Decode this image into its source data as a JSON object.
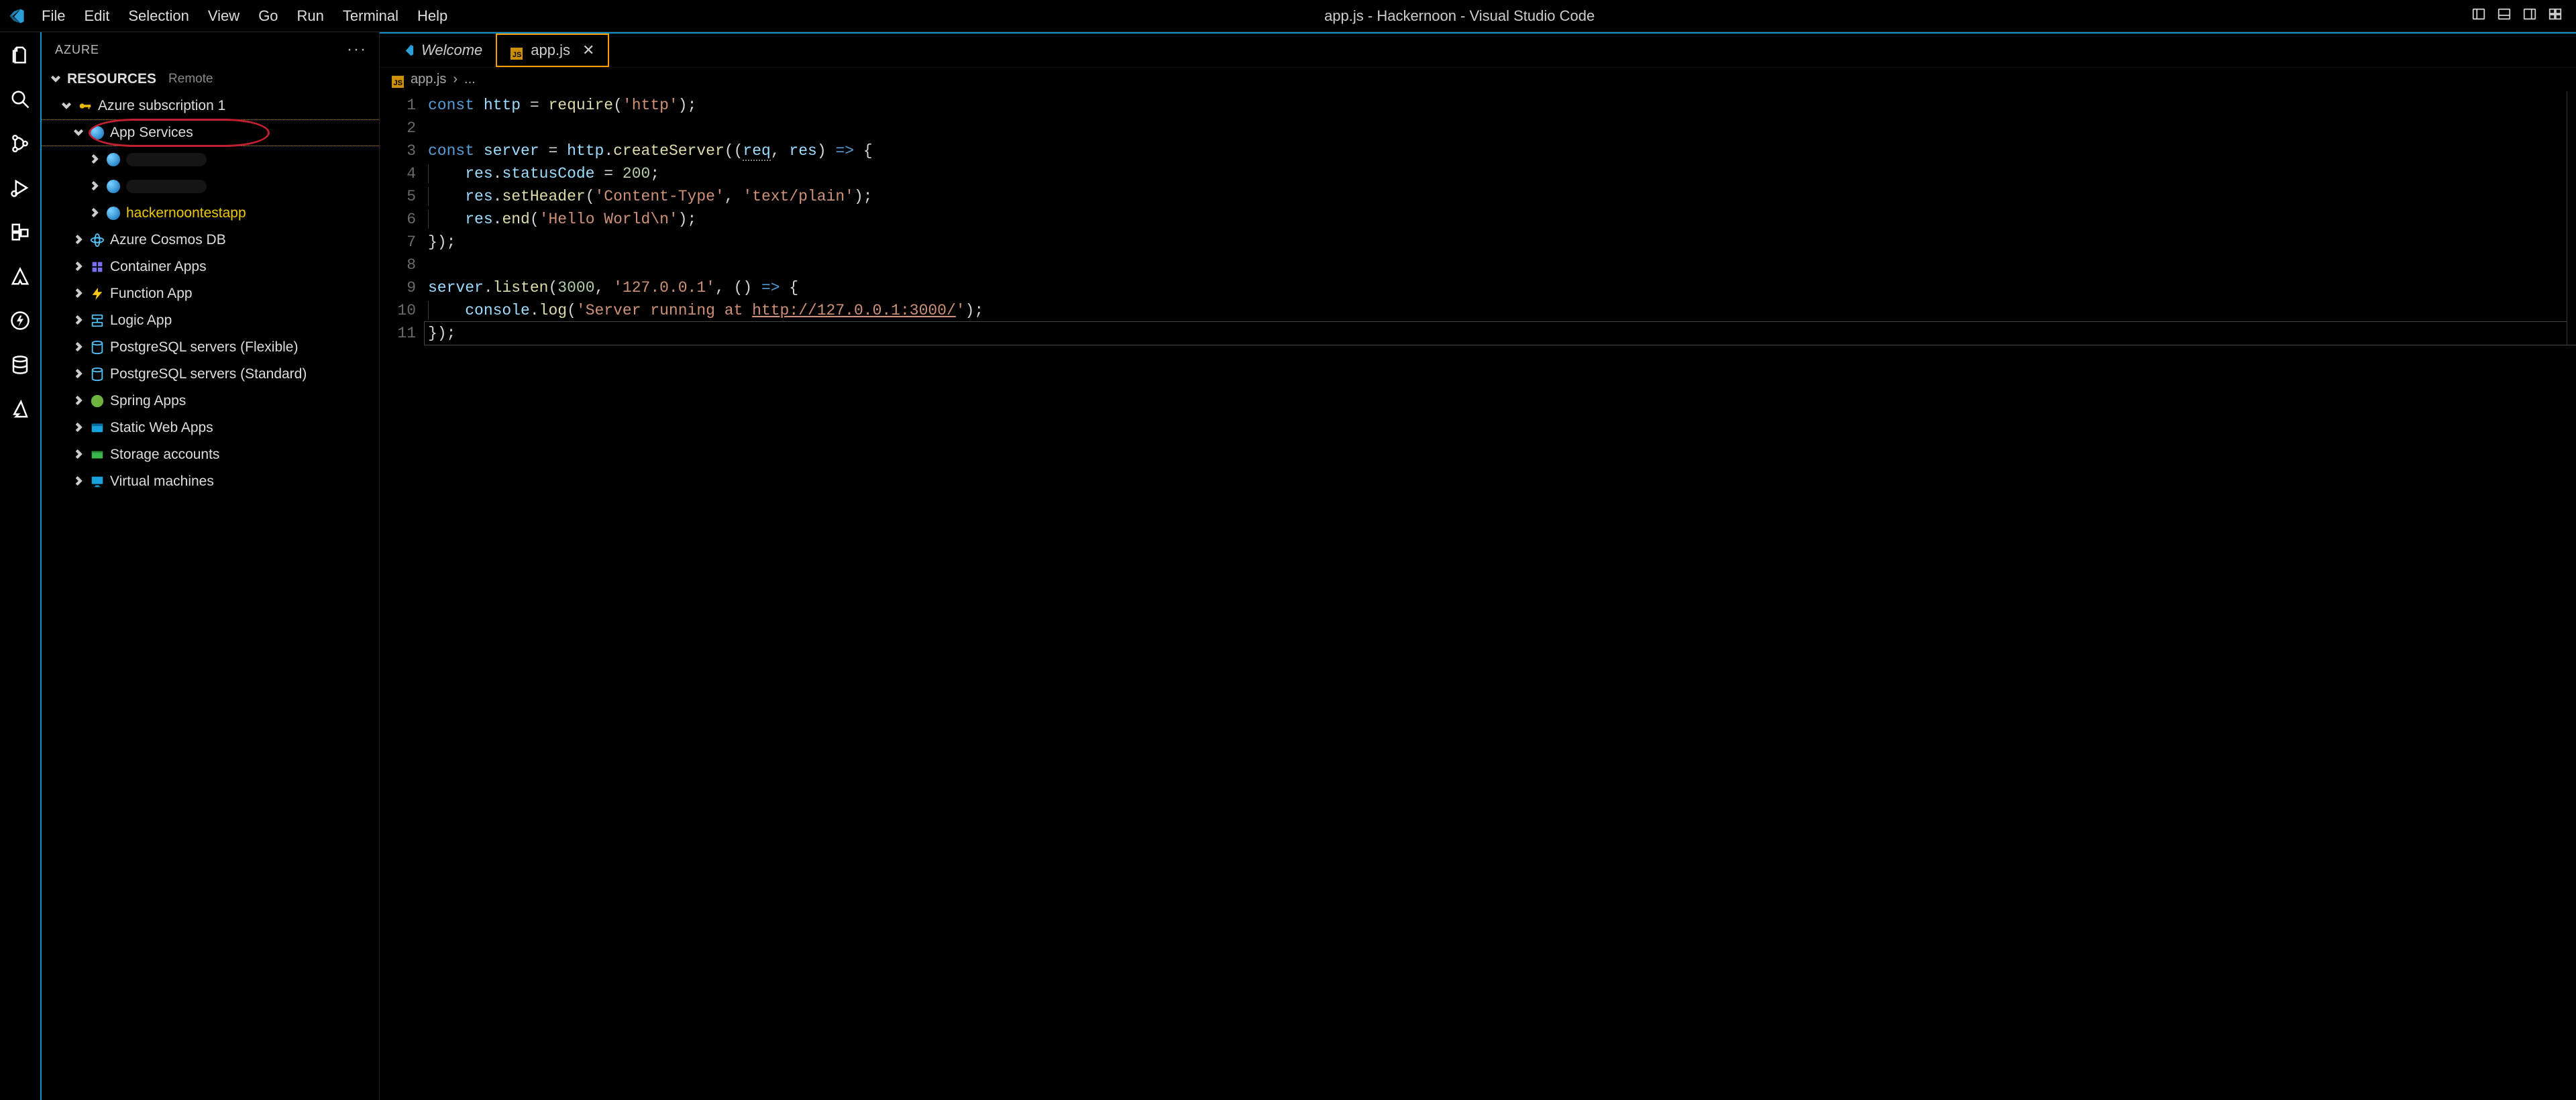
{
  "titlebar": {
    "menus": [
      "File",
      "Edit",
      "Selection",
      "View",
      "Go",
      "Run",
      "Terminal",
      "Help"
    ],
    "title": "app.js - Hackernoon - Visual Studio Code"
  },
  "sidebar": {
    "title": "AZURE",
    "section": {
      "label": "RESOURCES",
      "suffix": "Remote"
    },
    "subscription": "Azure subscription 1",
    "app_services_label": "App Services",
    "app_services_children": [
      {
        "name": "",
        "redacted": true
      },
      {
        "name": "",
        "redacted": true
      },
      {
        "name": "hackernoontestapp",
        "redacted": false,
        "highlight": true
      }
    ],
    "rest": [
      {
        "label": "Azure Cosmos DB",
        "icon": "cosmos"
      },
      {
        "label": "Container Apps",
        "icon": "container"
      },
      {
        "label": "Function App",
        "icon": "function"
      },
      {
        "label": "Logic App",
        "icon": "logic"
      },
      {
        "label": "PostgreSQL servers (Flexible)",
        "icon": "db"
      },
      {
        "label": "PostgreSQL servers (Standard)",
        "icon": "db"
      },
      {
        "label": "Spring Apps",
        "icon": "spring"
      },
      {
        "label": "Static Web Apps",
        "icon": "static"
      },
      {
        "label": "Storage accounts",
        "icon": "storage"
      },
      {
        "label": "Virtual machines",
        "icon": "vm"
      }
    ]
  },
  "tabs": [
    {
      "label": "Welcome",
      "icon": "vscode",
      "active": false
    },
    {
      "label": "app.js",
      "icon": "js",
      "active": true,
      "close": true
    }
  ],
  "breadcrumbs": {
    "file": "app.js",
    "rest": "..."
  },
  "code": {
    "lines": 11,
    "tokens": [
      [
        [
          "kw",
          "const "
        ],
        [
          "var",
          "http"
        ],
        [
          "p",
          " "
        ],
        [
          "p",
          "="
        ],
        [
          "p",
          " "
        ],
        [
          "fn",
          "require"
        ],
        [
          "p",
          "("
        ],
        [
          "str",
          "'http'"
        ],
        [
          "p",
          ")"
        ],
        [
          "p",
          ";"
        ]
      ],
      [],
      [
        [
          "kw",
          "const "
        ],
        [
          "var",
          "server"
        ],
        [
          "p",
          " "
        ],
        [
          "p",
          "="
        ],
        [
          "p",
          " "
        ],
        [
          "var",
          "http"
        ],
        [
          "p",
          "."
        ],
        [
          "fn",
          "createServer"
        ],
        [
          "p",
          "("
        ],
        [
          "p",
          "("
        ],
        [
          "squigvar",
          "req"
        ],
        [
          "p",
          ", "
        ],
        [
          "var",
          "res"
        ],
        [
          "p",
          ")"
        ],
        [
          "p",
          " "
        ],
        [
          "arrow",
          "=>"
        ],
        [
          "p",
          " "
        ],
        [
          "p",
          "{"
        ]
      ],
      [
        [
          "pad",
          "    "
        ],
        [
          "var",
          "res"
        ],
        [
          "p",
          "."
        ],
        [
          "var",
          "statusCode"
        ],
        [
          "p",
          " "
        ],
        [
          "p",
          "="
        ],
        [
          "p",
          " "
        ],
        [
          "num",
          "200"
        ],
        [
          "p",
          ";"
        ]
      ],
      [
        [
          "pad",
          "    "
        ],
        [
          "var",
          "res"
        ],
        [
          "p",
          "."
        ],
        [
          "fn",
          "setHeader"
        ],
        [
          "p",
          "("
        ],
        [
          "str",
          "'Content-Type'"
        ],
        [
          "p",
          ", "
        ],
        [
          "str",
          "'text/plain'"
        ],
        [
          "p",
          ")"
        ],
        [
          "p",
          ";"
        ]
      ],
      [
        [
          "pad",
          "    "
        ],
        [
          "var",
          "res"
        ],
        [
          "p",
          "."
        ],
        [
          "fn",
          "end"
        ],
        [
          "p",
          "("
        ],
        [
          "str",
          "'Hello World\\n'"
        ],
        [
          "p",
          ")"
        ],
        [
          "p",
          ";"
        ]
      ],
      [
        [
          "p",
          "}"
        ],
        [
          "p",
          ")"
        ],
        [
          "p",
          ";"
        ]
      ],
      [],
      [
        [
          "var",
          "server"
        ],
        [
          "p",
          "."
        ],
        [
          "fn",
          "listen"
        ],
        [
          "p",
          "("
        ],
        [
          "num",
          "3000"
        ],
        [
          "p",
          ", "
        ],
        [
          "str",
          "'127.0.0.1'"
        ],
        [
          "p",
          ", "
        ],
        [
          "p",
          "("
        ],
        [
          "p",
          ")"
        ],
        [
          "p",
          " "
        ],
        [
          "arrow",
          "=>"
        ],
        [
          "p",
          " "
        ],
        [
          "p",
          "{"
        ]
      ],
      [
        [
          "pad",
          "    "
        ],
        [
          "var",
          "console"
        ],
        [
          "p",
          "."
        ],
        [
          "fn",
          "log"
        ],
        [
          "p",
          "("
        ],
        [
          "str",
          "'Server running at "
        ],
        [
          "link",
          "http://127.0.0.1:3000/"
        ],
        [
          "str",
          "'"
        ],
        [
          "p",
          ")"
        ],
        [
          "p",
          ";"
        ]
      ],
      [
        [
          "p",
          "}"
        ],
        [
          "p",
          ")"
        ],
        [
          "p",
          ";"
        ]
      ]
    ]
  }
}
